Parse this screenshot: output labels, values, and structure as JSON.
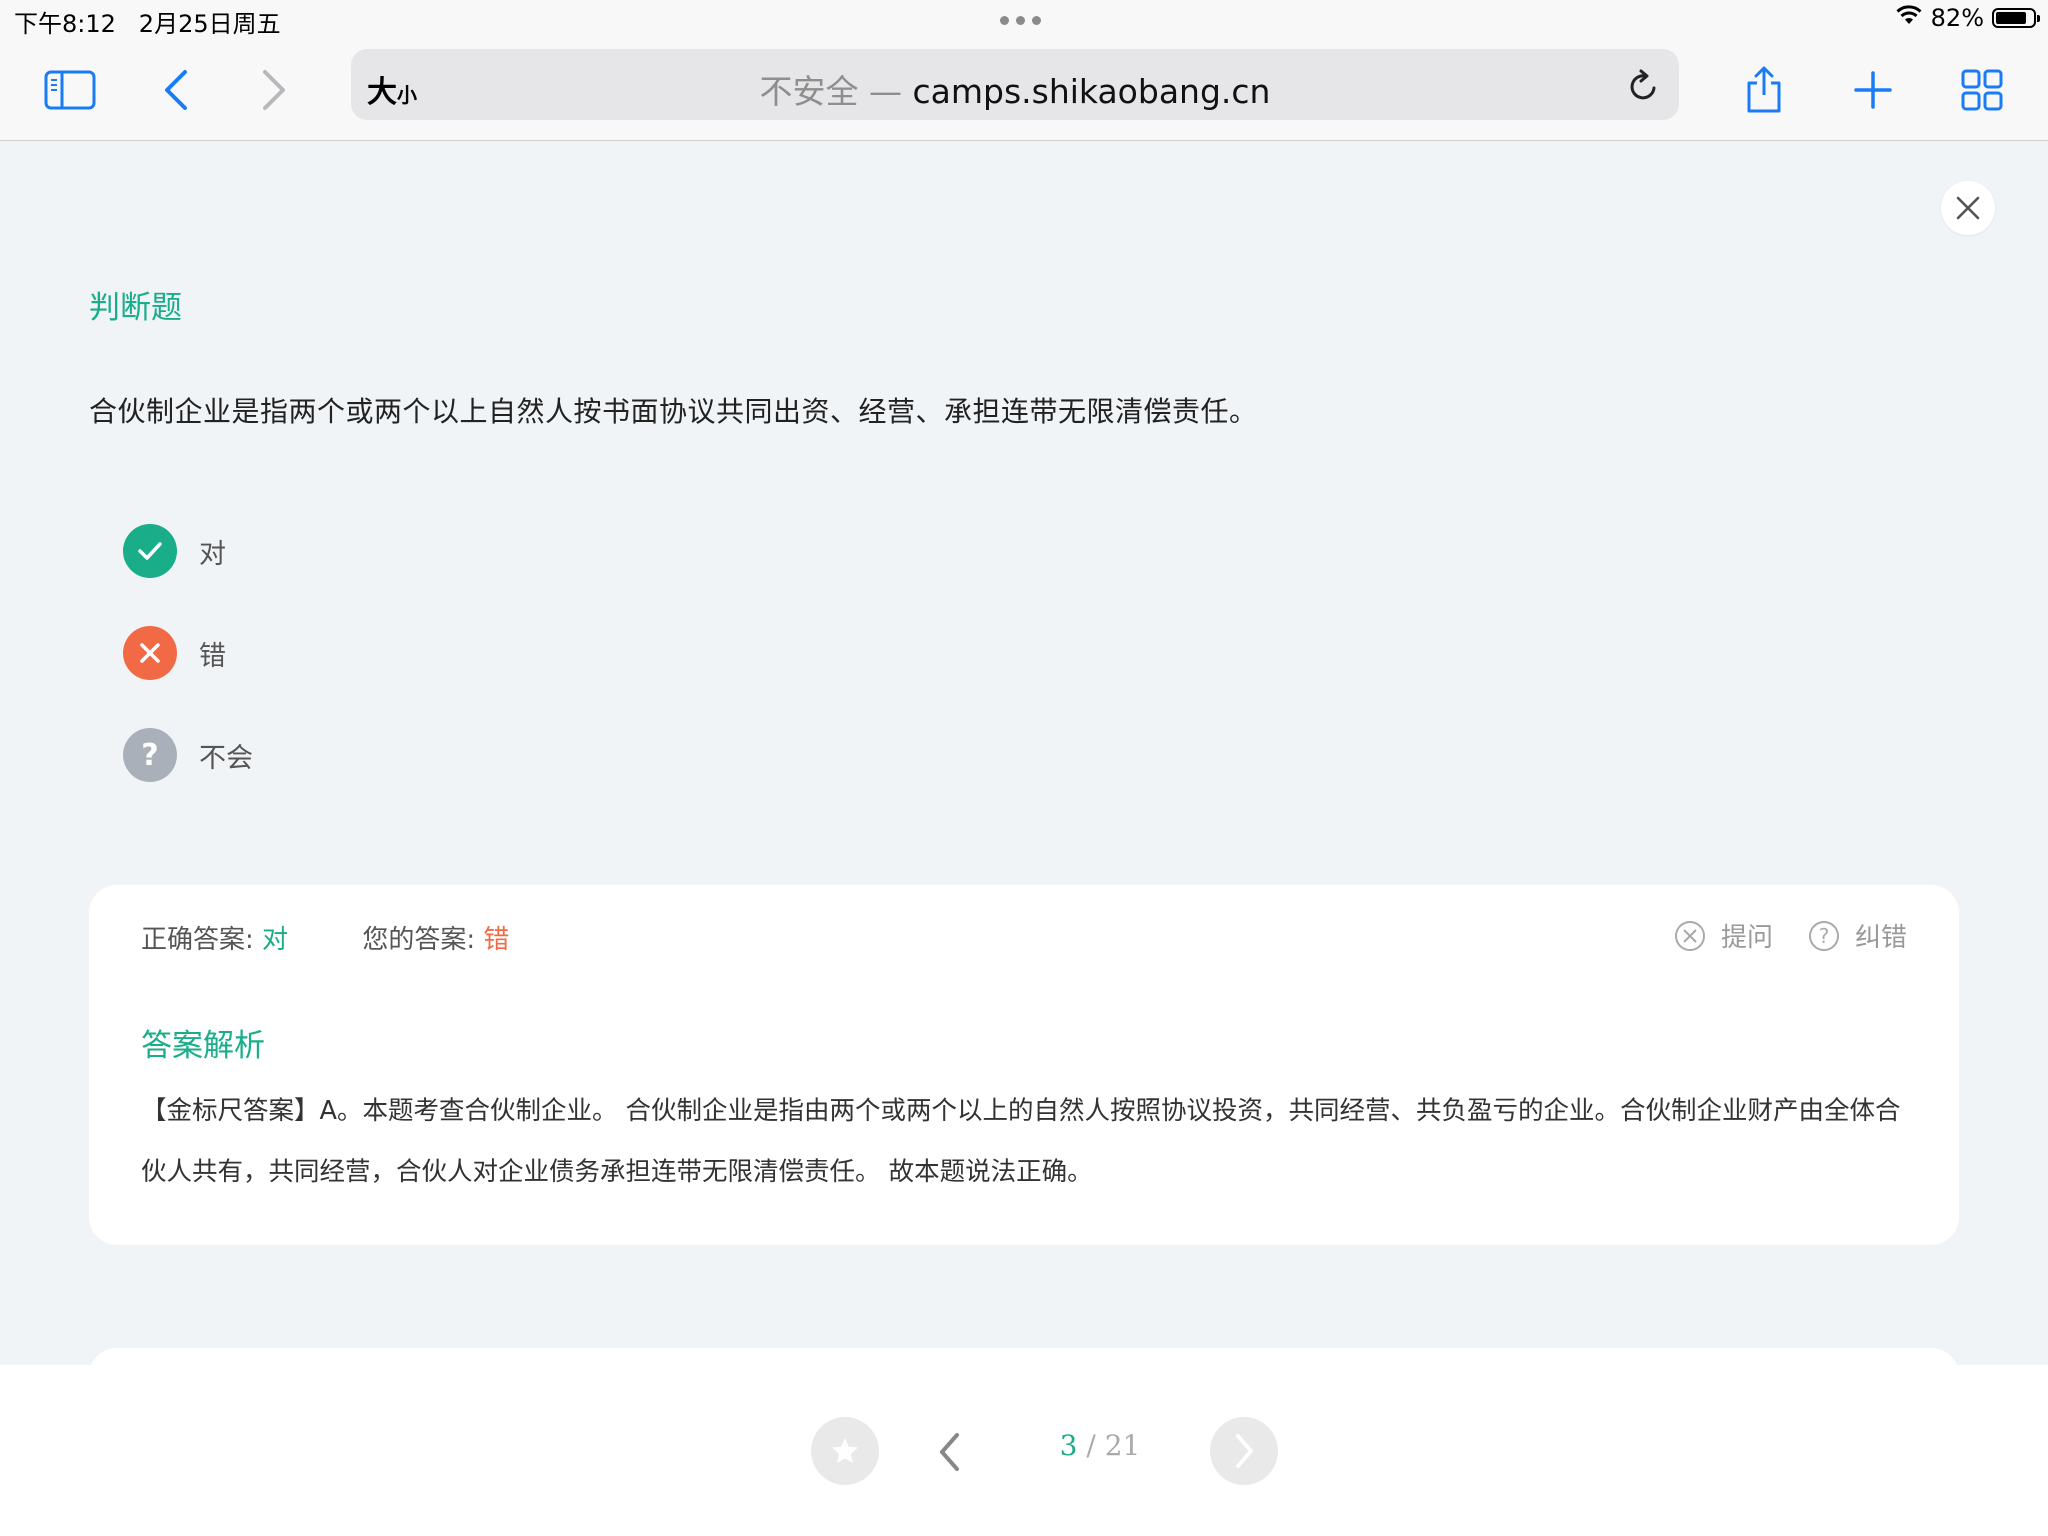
{
  "status_bar": {
    "time": "下午8:12",
    "date": "2月25日周五",
    "battery": "82%",
    "battery_level": 0.82
  },
  "browser": {
    "text_size_label": "大",
    "text_size_small": "小",
    "insecure_label": "不安全 —",
    "domain": "camps.shikaobang.cn"
  },
  "question": {
    "type_label": "判断题",
    "text": "合伙制企业是指两个或两个以上自然人按书面协议共同出资、经营、承担连带无限清偿责任。",
    "options": [
      {
        "label": "对",
        "state": "correct",
        "color": "#1aad8a"
      },
      {
        "label": "错",
        "state": "wrong",
        "color": "#f26a45"
      },
      {
        "label": "不会",
        "state": "unknown",
        "color": "#a9b0ba"
      }
    ]
  },
  "answer_card": {
    "correct_label": "正确答案:",
    "correct_value": "对",
    "mine_label": "您的答案:",
    "mine_value": "错",
    "ask_label": "提问",
    "report_label": "纠错",
    "analysis_title": "答案解析",
    "analysis_text": "【金标尺答案】A。本题考查合伙制企业。 合伙制企业是指由两个或两个以上的自然人按照协议投资，共同经营、共负盈亏的企业。合伙制企业财产由全体合伙人共有，共同经营，合伙人对企业债务承担连带无限清偿责任。 故本题说法正确。"
  },
  "pager": {
    "current": "3",
    "separator": " / ",
    "total": "21"
  },
  "colors": {
    "accent": "#1aad8a",
    "wrong": "#f26a45",
    "ios_blue": "#1a7cf5"
  }
}
